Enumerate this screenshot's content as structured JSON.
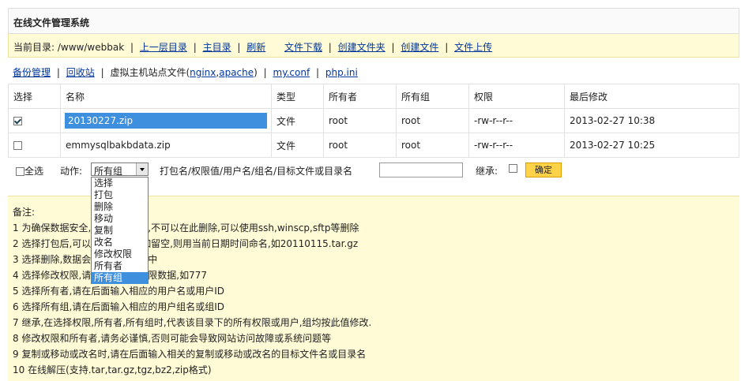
{
  "title": "在线文件管理系统",
  "path_bar": {
    "label": "当前目录:",
    "path": "/www/webbak",
    "links": [
      "上一层目录",
      "主目录",
      "刷新",
      "文件下载",
      "创建文件夹",
      "创建文件",
      "文件上传"
    ]
  },
  "tools_bar": {
    "backup": "备份管理",
    "recycle": "回收站",
    "vhost_text": "虚拟主机站点文件(",
    "nginx": "nginx",
    "comma": ",",
    "apache": "apache",
    "close_paren": ")",
    "myconf": "my.conf",
    "phpini": "php.ini"
  },
  "table": {
    "headers": [
      "选择",
      "名称",
      "类型",
      "所有者",
      "所有组",
      "权限",
      "最后修改"
    ],
    "rows": [
      {
        "checked": true,
        "name": "20130227.zip",
        "type": "文件",
        "owner": "root",
        "group": "root",
        "perm": "-rw-r--r--",
        "modified": "2013-02-27 10:38"
      },
      {
        "checked": false,
        "name": "emmysqlbakbdata.zip",
        "type": "文件",
        "owner": "root",
        "group": "root",
        "perm": "-rw-r--r--",
        "modified": "2013-02-27 10:25"
      }
    ]
  },
  "action_row": {
    "select_all": "全选",
    "action_label": "动作:",
    "action_value": "所有组",
    "input_label": "打包名/权限值/用户名/组名/目标文件或目录名",
    "inherit_label": "继承:",
    "ok": "确定"
  },
  "dropdown_options": [
    "选择",
    "打包",
    "删除",
    "移动",
    "复制",
    "改名",
    "修改权限",
    "所有者",
    "所有组"
  ],
  "notes": [
    "备注:",
    "1 为确保数据安全,回收站的内容,不可以在此删除,可以使用ssh,winscp,sftp等删除",
    "2 选择打包后,可以输入文件名,如留空,则用当前日期时间命名,如20110115.tar.gz",
    "3 选择删除,数据会移动到回收站中",
    "4 选择修改权限,请在后面输入权限数据,如777",
    "5 选择所有者,请在后面输入相应的用户名或用户ID",
    "6 选择所有组,请在后面输入相应的用户组名或组ID",
    "7 继承,在选择权限,所有者,所有组时,代表该目录下的所有权限或用户,组均按此值修改.",
    "8 修改权限和所有者,请务必谨慎,否则可能会导致网站访问故障或系统问题等",
    "9 复制或移动或改名时,请在后面输入相关的复制或移动或改名的目标文件名或目录名",
    "10 在线解压(支持.tar,tar.gz,tgz,bz2,zip格式)"
  ]
}
